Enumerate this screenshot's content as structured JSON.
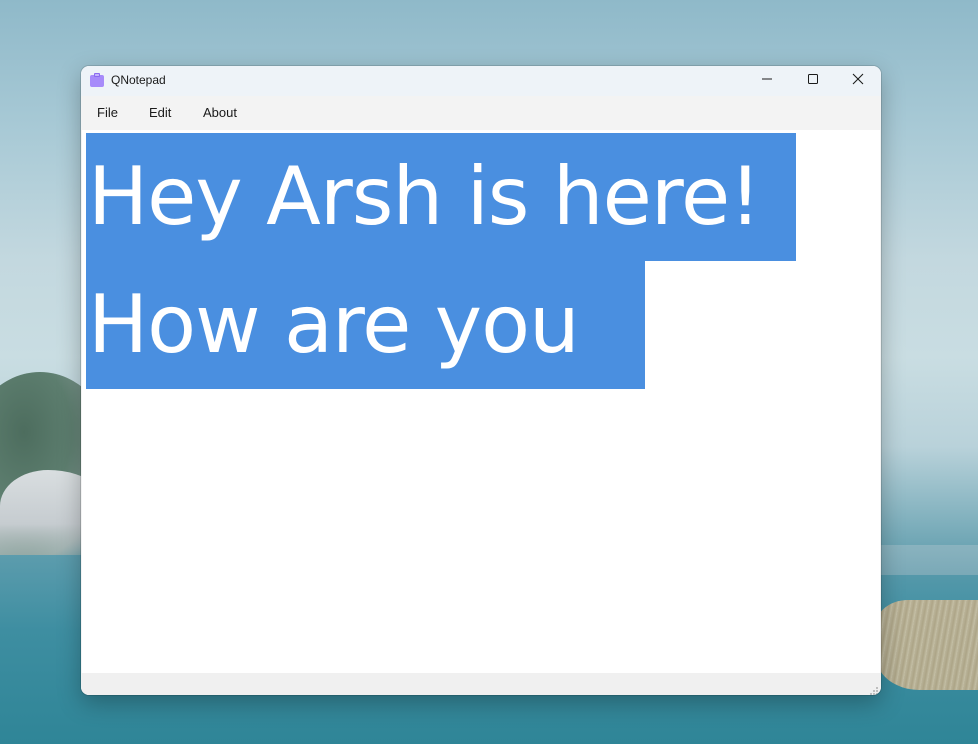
{
  "window": {
    "title": "QNotepad",
    "icon": "clipboard-icon",
    "controls": {
      "minimize": "minimize-icon",
      "maximize": "maximize-icon",
      "close": "close-icon"
    }
  },
  "menu": {
    "items": [
      {
        "label": "File"
      },
      {
        "label": "Edit"
      },
      {
        "label": "About"
      }
    ]
  },
  "editor": {
    "lines": [
      "Hey Arsh is here!",
      "How are you "
    ],
    "selection_color": "#4a8fe0",
    "text_color": "#ffffff"
  },
  "colors": {
    "app_icon": "#a78bfa"
  }
}
